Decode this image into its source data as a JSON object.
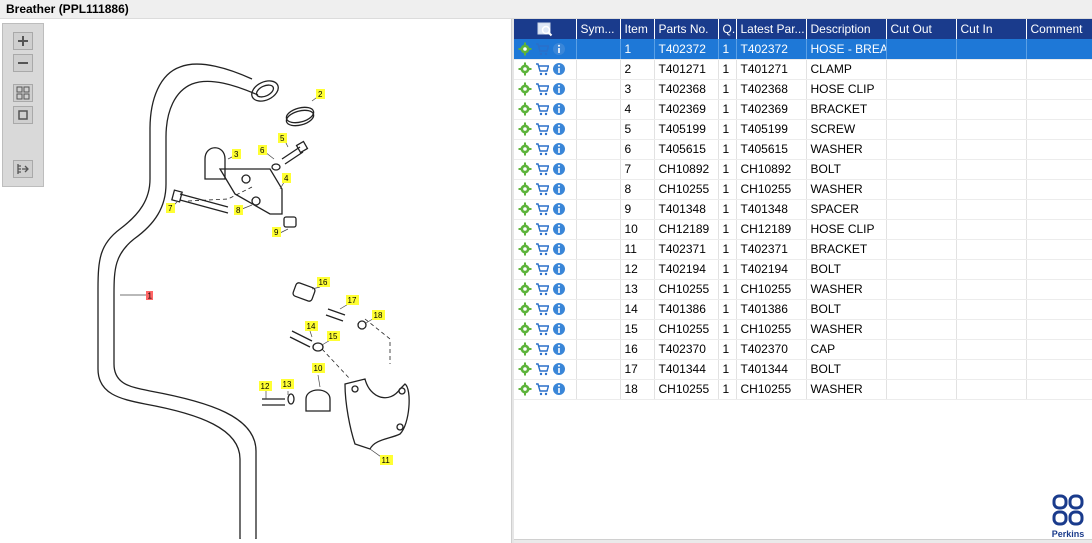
{
  "window": {
    "title": "Breather (PPL111886)"
  },
  "toolbar": {
    "buttons": [
      {
        "name": "zoom-in-button",
        "icon": "plus-icon"
      },
      {
        "name": "zoom-out-button",
        "icon": "minus-icon"
      },
      {
        "name": "fit-grid-button",
        "icon": "grid-icon"
      },
      {
        "name": "fit-window-button",
        "icon": "square-icon"
      },
      {
        "name": "export-button",
        "icon": "export-icon"
      }
    ]
  },
  "diagram": {
    "callouts": [
      "1",
      "2",
      "3",
      "4",
      "5",
      "6",
      "7",
      "8",
      "9",
      "10",
      "11",
      "12",
      "13",
      "14",
      "15",
      "16",
      "17",
      "18"
    ]
  },
  "table": {
    "columns": [
      "",
      "Sym...",
      "Item",
      "Parts No.",
      "Q.",
      "Latest Par...",
      "Description",
      "Cut Out",
      "Cut In",
      "Comment"
    ],
    "selected_index": 0,
    "rows": [
      {
        "item": "1",
        "part": "T402372",
        "qty": "1",
        "latest": "T402372",
        "desc": "HOSE - BREATH"
      },
      {
        "item": "2",
        "part": "T401271",
        "qty": "1",
        "latest": "T401271",
        "desc": "CLAMP"
      },
      {
        "item": "3",
        "part": "T402368",
        "qty": "1",
        "latest": "T402368",
        "desc": "HOSE CLIP"
      },
      {
        "item": "4",
        "part": "T402369",
        "qty": "1",
        "latest": "T402369",
        "desc": "BRACKET"
      },
      {
        "item": "5",
        "part": "T405199",
        "qty": "1",
        "latest": "T405199",
        "desc": "SCREW"
      },
      {
        "item": "6",
        "part": "T405615",
        "qty": "1",
        "latest": "T405615",
        "desc": "WASHER"
      },
      {
        "item": "7",
        "part": "CH10892",
        "qty": "1",
        "latest": "CH10892",
        "desc": "BOLT"
      },
      {
        "item": "8",
        "part": "CH10255",
        "qty": "1",
        "latest": "CH10255",
        "desc": "WASHER"
      },
      {
        "item": "9",
        "part": "T401348",
        "qty": "1",
        "latest": "T401348",
        "desc": "SPACER"
      },
      {
        "item": "10",
        "part": "CH12189",
        "qty": "1",
        "latest": "CH12189",
        "desc": "HOSE CLIP"
      },
      {
        "item": "11",
        "part": "T402371",
        "qty": "1",
        "latest": "T402371",
        "desc": "BRACKET"
      },
      {
        "item": "12",
        "part": "T402194",
        "qty": "1",
        "latest": "T402194",
        "desc": "BOLT"
      },
      {
        "item": "13",
        "part": "CH10255",
        "qty": "1",
        "latest": "CH10255",
        "desc": "WASHER"
      },
      {
        "item": "14",
        "part": "T401386",
        "qty": "1",
        "latest": "T401386",
        "desc": "BOLT"
      },
      {
        "item": "15",
        "part": "CH10255",
        "qty": "1",
        "latest": "CH10255",
        "desc": "WASHER"
      },
      {
        "item": "16",
        "part": "T402370",
        "qty": "1",
        "latest": "T402370",
        "desc": "CAP"
      },
      {
        "item": "17",
        "part": "T401344",
        "qty": "1",
        "latest": "T401344",
        "desc": "BOLT"
      },
      {
        "item": "18",
        "part": "CH10255",
        "qty": "1",
        "latest": "CH10255",
        "desc": "WASHER"
      }
    ]
  },
  "row_icons": [
    "gear-icon",
    "cart-icon",
    "info-icon"
  ],
  "logo": {
    "text": "Perkins"
  },
  "colors": {
    "header": "#1a3b8c",
    "selected": "#1e78d7",
    "callout": "#ffff33",
    "callout_selected": "#ff6666"
  }
}
